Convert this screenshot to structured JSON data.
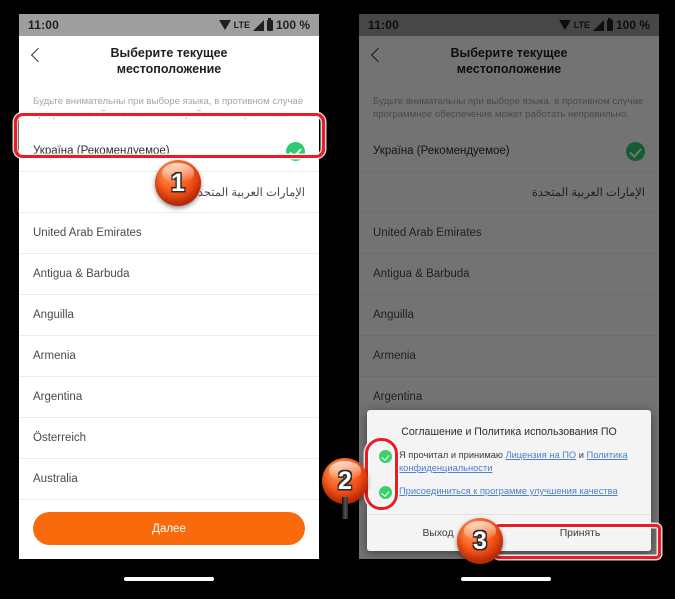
{
  "meta": {
    "badge_1": "1",
    "badge_2": "2",
    "badge_3": "3",
    "accent_orange": "#f96a0d",
    "accent_green": "#2ecc71",
    "highlight_red": "#ed1c24",
    "link_blue": "#4a7ed0"
  },
  "status_bar": {
    "time": "11:00",
    "network": "LTE",
    "battery": "100 %",
    "icons": [
      "wifi-icon",
      "signal-icon",
      "battery-icon"
    ]
  },
  "header": {
    "title": "Выберите текущее\nместоположение",
    "title_line1": "Выберите текущее",
    "title_line2": "местоположение",
    "back_icon": "chevron-left-icon"
  },
  "hint": "Будьте внимательны при выборе языка, в противном случае программное обеспечение может работать неправильно.",
  "country_list": [
    {
      "label": "Україна (Рекомендуемое)",
      "selected": true,
      "rtl": false
    },
    {
      "label": "الإمارات العربية المتحدة",
      "selected": false,
      "rtl": true
    },
    {
      "label": "United Arab Emirates",
      "selected": false,
      "rtl": false
    },
    {
      "label": "Antigua & Barbuda",
      "selected": false,
      "rtl": false
    },
    {
      "label": "Anguilla",
      "selected": false,
      "rtl": false
    },
    {
      "label": "Armenia",
      "selected": false,
      "rtl": false
    },
    {
      "label": "Argentina",
      "selected": false,
      "rtl": false
    },
    {
      "label": "Österreich",
      "selected": false,
      "rtl": false
    },
    {
      "label": "Australia",
      "selected": false,
      "rtl": false
    }
  ],
  "cta": {
    "label": "Далее"
  },
  "dialog": {
    "title": "Соглашение и Политика использования ПО",
    "consent_1": {
      "prefix": "Я прочитал и принимаю ",
      "link_1": "Лицензия на ПО",
      "middle": " и ",
      "link_2": "Политика конфиденциальности"
    },
    "consent_2": {
      "link": "Присоединиться к программе улучшения качества"
    },
    "exit_label": "Выход",
    "accept_label": "Принять"
  }
}
